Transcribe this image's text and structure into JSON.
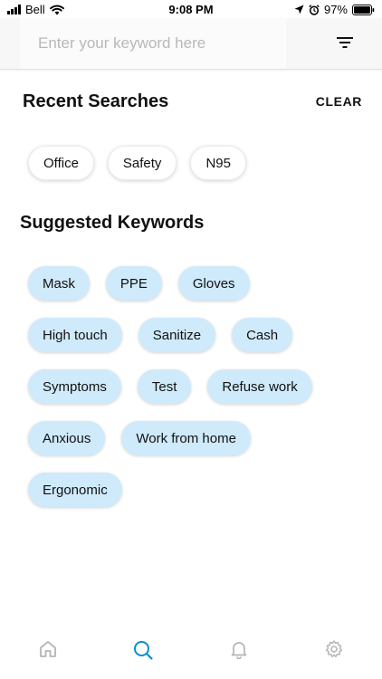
{
  "status_bar": {
    "carrier": "Bell",
    "time": "9:08 PM",
    "battery": "97%"
  },
  "search": {
    "placeholder": "Enter your keyword here"
  },
  "recent": {
    "title": "Recent Searches",
    "clear_label": "CLEAR",
    "items": [
      "Office",
      "Safety",
      "N95"
    ]
  },
  "suggested": {
    "title": "Suggested Keywords",
    "items": [
      "Mask",
      "PPE",
      "Gloves",
      "High touch",
      "Sanitize",
      "Cash",
      "Symptoms",
      "Test",
      "Refuse work",
      "Anxious",
      "Work from home",
      "Ergonomic"
    ]
  },
  "tab_bar": {
    "tabs": [
      {
        "icon": "home-icon"
      },
      {
        "icon": "search-icon",
        "active": true
      },
      {
        "icon": "bell-icon"
      },
      {
        "icon": "settings-icon"
      }
    ]
  },
  "colors": {
    "chip_suggested_bg": "#cfeafb",
    "tab_active": "#0a8fcf",
    "tab_inactive": "#b5b5b5"
  }
}
